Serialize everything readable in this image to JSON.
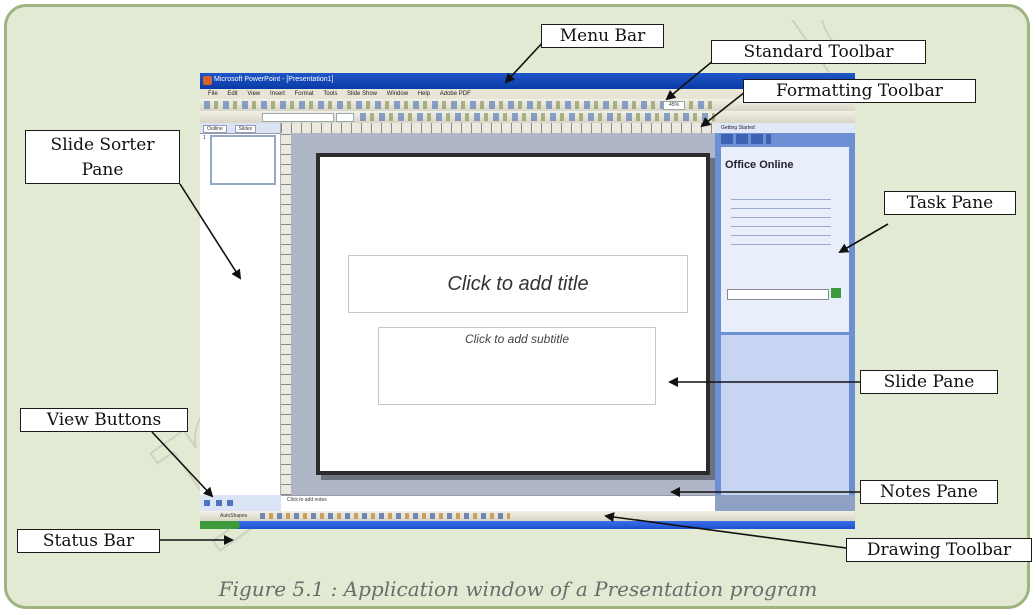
{
  "callouts": {
    "menu_bar": "Menu Bar",
    "standard_toolbar": "Standard Toolbar",
    "formatting_toolbar": "Formatting Toolbar",
    "slide_sorter_pane": "Slide Sorter Pane",
    "task_pane": "Task Pane",
    "slide_pane": "Slide Pane",
    "view_buttons": "View Buttons",
    "notes_pane": "Notes Pane",
    "status_bar": "Status Bar",
    "drawing_toolbar": "Drawing Toolbar"
  },
  "caption": "Figure 5.1 : Application window of a Presentation program",
  "watermark": "not to be",
  "app": {
    "title": "Microsoft PowerPoint - [Presentation1]",
    "menu": [
      "File",
      "Edit",
      "View",
      "Insert",
      "Format",
      "Tools",
      "Slide Show",
      "Window",
      "Help",
      "Adobe PDF"
    ],
    "zoom": "45%",
    "outline_tab": "Outline",
    "slides_tab": "Slides",
    "thumb_number": "1",
    "slide_title_placeholder": "Click to add title",
    "slide_subtitle_placeholder": "Click to add subtitle",
    "notes_placeholder": "Click to add notes",
    "task_pane_title": "Getting Started",
    "office_online": "Office Online",
    "draw_label": "AutoShapes",
    "start": "start"
  },
  "colors": {
    "frame_bg": "#e3ead4",
    "frame_border": "#9fb480",
    "title_bar": "#0a3aa6",
    "task_pane": "#6d8fd4"
  }
}
